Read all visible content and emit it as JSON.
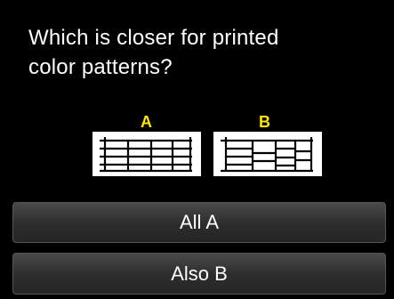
{
  "question": {
    "line1": "Which is closer for printed",
    "line2": "color patterns?"
  },
  "patterns": [
    {
      "label": "A"
    },
    {
      "label": "B"
    }
  ],
  "options": [
    {
      "label": "All A"
    },
    {
      "label": "Also B"
    }
  ],
  "colors": {
    "background": "#000000",
    "text": "#ffffff",
    "pattern_label": "#ffe600",
    "button": "#3a3a3a"
  }
}
